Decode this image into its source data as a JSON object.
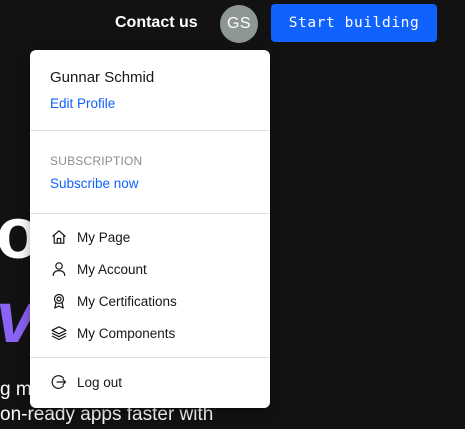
{
  "header": {
    "contact_label": "Contact us",
    "avatar_initials": "GS",
    "cta_label": "Start building"
  },
  "hero": {
    "line1_fragment": "o",
    "line2_fragment": "va",
    "subtitle_line1": "g m",
    "subtitle_line2": "on-ready apps faster with"
  },
  "user_menu": {
    "user_name": "Gunnar Schmid",
    "edit_profile_label": "Edit Profile",
    "subscription_heading": "SUBSCRIPTION",
    "subscribe_label": "Subscribe now",
    "items": [
      {
        "label": "My Page",
        "icon": "home-icon"
      },
      {
        "label": "My Account",
        "icon": "user-icon"
      },
      {
        "label": "My Certifications",
        "icon": "badge-icon"
      },
      {
        "label": "My Components",
        "icon": "layers-icon"
      }
    ],
    "logout_label": "Log out"
  },
  "colors": {
    "background": "#121212",
    "accent_blue": "#0f62fe",
    "hero_purple": "#8a63f4",
    "avatar_bg": "#8e9794"
  }
}
